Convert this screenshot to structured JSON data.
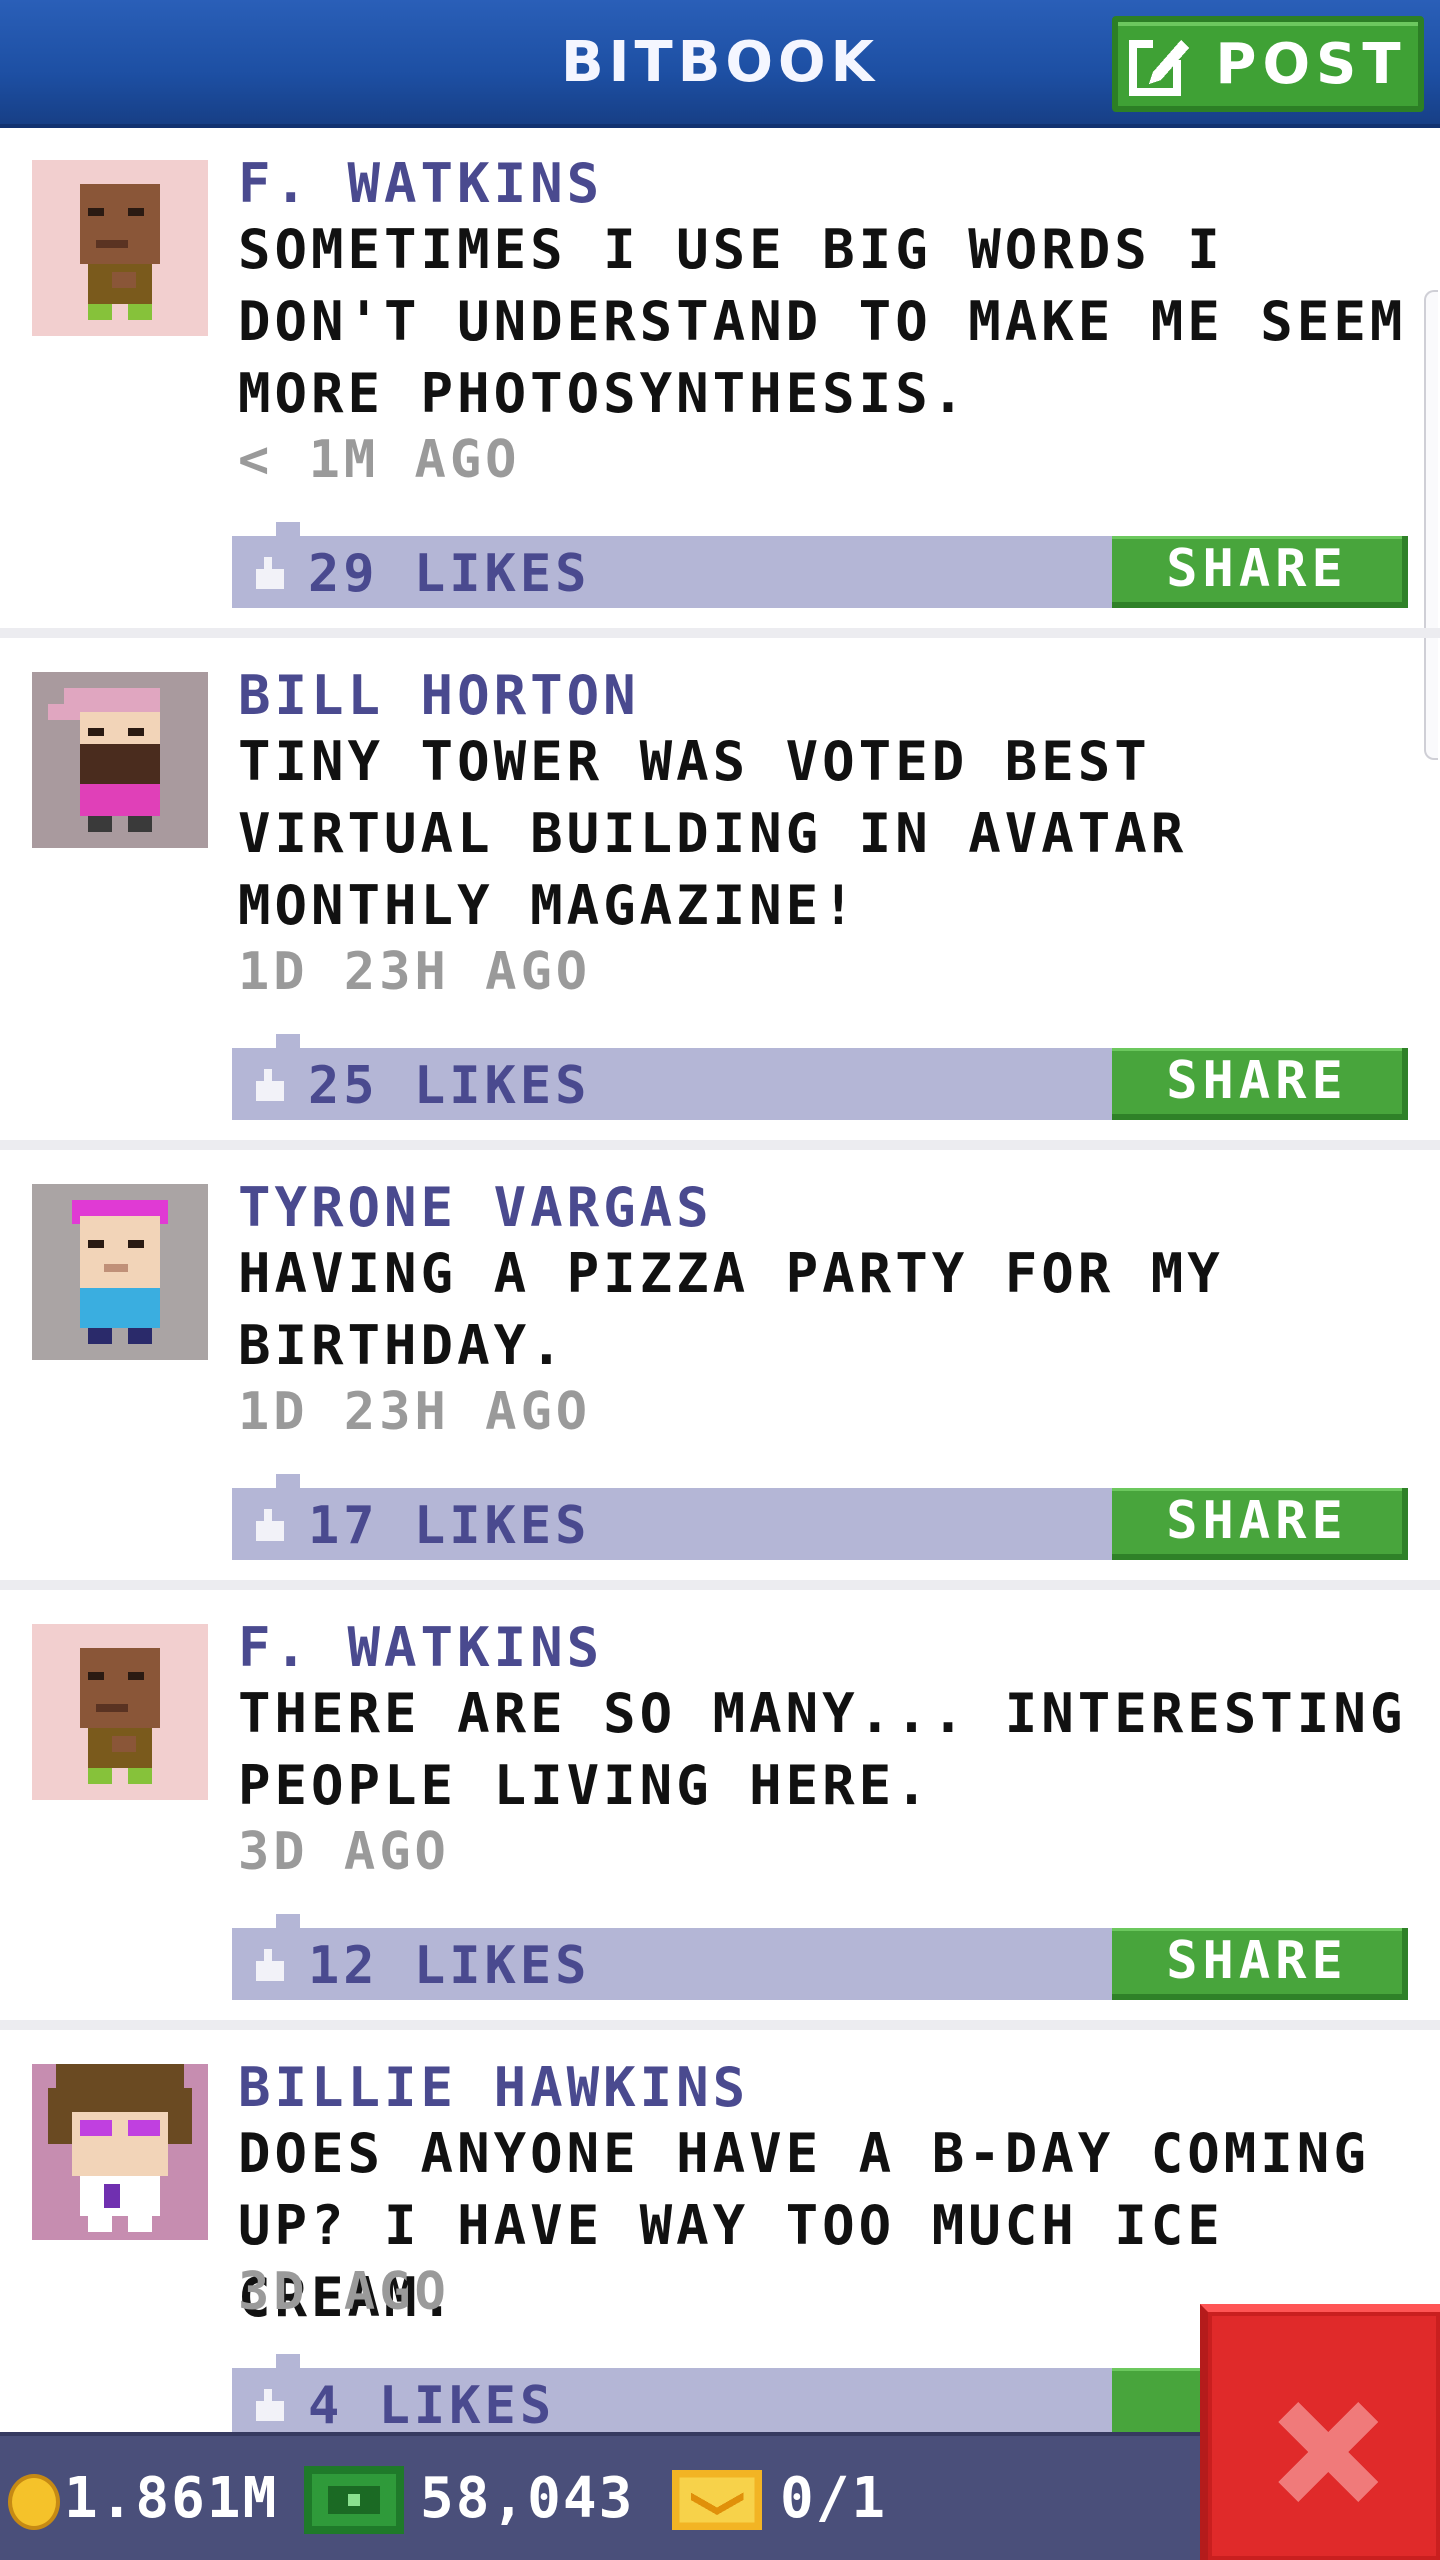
{
  "header": {
    "title": "BITBOOK",
    "post_label": "POST"
  },
  "posts": [
    {
      "author": "F. WATKINS",
      "message": "SOMETIMES I USE BIG WORDS I DON'T UNDERSTAND TO MAKE ME SEEM MORE PHOTOSYNTHESIS.",
      "time": "< 1M AGO",
      "likes": "29 LIKES",
      "share_label": "SHARE",
      "avatar_bg": "#f2cfcf"
    },
    {
      "author": "BILL HORTON",
      "message": "TINY TOWER WAS VOTED BEST VIRTUAL BUILDING IN AVATAR MONTHLY MAGAZINE!",
      "time": "1D 23H AGO",
      "likes": "25 LIKES",
      "share_label": "SHARE",
      "avatar_bg": "#a99a9e"
    },
    {
      "author": "TYRONE VARGAS",
      "message": "HAVING A PIZZA PARTY FOR MY BIRTHDAY.",
      "time": "1D 23H AGO",
      "likes": "17 LIKES",
      "share_label": "SHARE",
      "avatar_bg": "#aaa4a4"
    },
    {
      "author": "F. WATKINS",
      "message": "THERE ARE SO MANY... INTERESTING PEOPLE LIVING HERE.",
      "time": "3D AGO",
      "likes": "12 LIKES",
      "share_label": "SHARE",
      "avatar_bg": "#f2cfcf"
    },
    {
      "author": "BILLIE HAWKINS",
      "message": "DOES ANYONE HAVE A B-DAY COMING UP? I HAVE WAY TOO MUCH ICE CREAM.",
      "time": "3D AGO",
      "likes": "4 LIKES",
      "share_label": "S",
      "avatar_bg": "#c68db0"
    }
  ],
  "footer": {
    "coins": "1.861M",
    "bux": "58,043",
    "tickets": "0/1"
  },
  "icons": {
    "post": "edit-icon",
    "like": "thumbs-up-icon",
    "coin": "coin-icon",
    "bux": "bux-icon",
    "ticket": "ticket-icon",
    "close": "close-icon"
  },
  "colors": {
    "header": "#1d4fa3",
    "post_button": "#3fa135",
    "name_text": "#4a4a8f",
    "like_bar": "#b4b6d6",
    "share_button": "#48a53c",
    "footer": "#4a4f7a",
    "close_button": "#e02a2a"
  }
}
